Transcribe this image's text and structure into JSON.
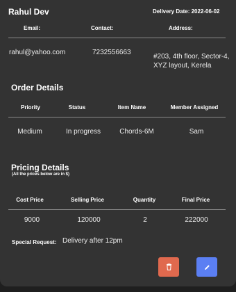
{
  "customer": {
    "name": "Rahul Dev",
    "delivery_date": "Delivery Date: 2022-06-02",
    "headers": {
      "email": "Email:",
      "contact": "Contact:",
      "address": "Address:"
    },
    "email": "rahul@yahoo.com",
    "contact": "7232556663",
    "address_line1": "#203, 4th floor, Sector-4,",
    "address_line2": "XYZ layout, Kerela"
  },
  "order": {
    "title": "Order Details",
    "headers": {
      "priority": "Priority",
      "status": "Status",
      "item": "Item Name",
      "member": "Member Assigned"
    },
    "priority": "Medium",
    "status": "In progress",
    "item": "Chords-6M",
    "member": "Sam"
  },
  "pricing": {
    "title": "Pricing Details",
    "note": "(All the prices below are in $)",
    "headers": {
      "cost": "Cost Price",
      "selling": "Selling Price",
      "quantity": "Quantity",
      "final": "Final Price"
    },
    "cost": "9000",
    "selling": "120000",
    "quantity": "2",
    "final": "222000"
  },
  "special": {
    "label": "Special Request:",
    "value": "Delivery after 12pm"
  },
  "actions": {
    "delete_icon": "trash-icon",
    "edit_icon": "pencil-icon",
    "delete_color": "#e0694e",
    "edit_color": "#5b7ff3"
  }
}
